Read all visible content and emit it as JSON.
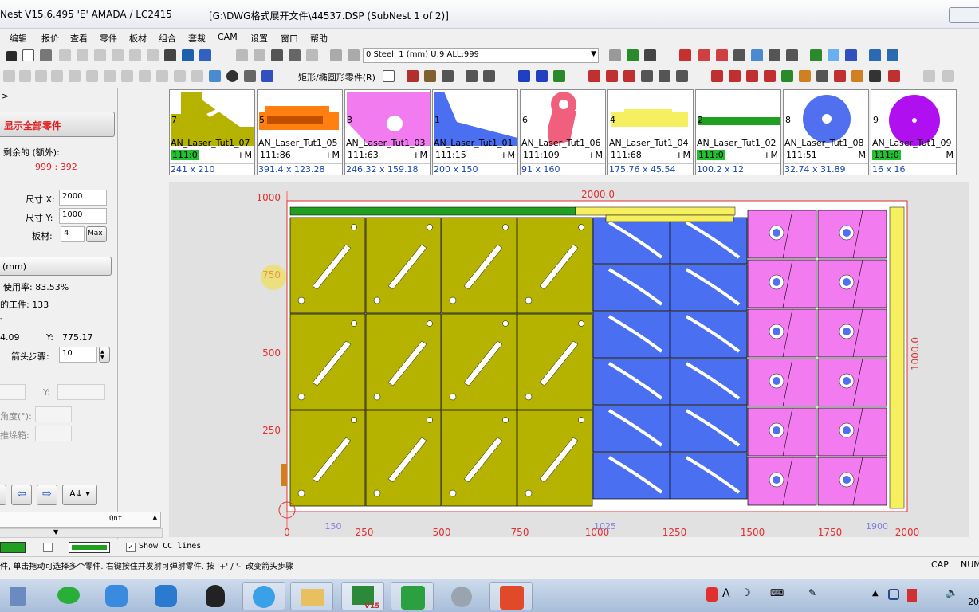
{
  "window": {
    "title_left": "Nest V15.6.495  'E'  AMADA / LC2415",
    "title_right": "[G:\\DWG格式展开文件\\44537.DSP (SubNest 1 of 2)]"
  },
  "menu": [
    "编辑",
    "报价",
    "查看",
    "零件",
    "板材",
    "组合",
    "套裁",
    "CAM",
    "设置",
    "窗口",
    "帮助"
  ],
  "toolbar": {
    "sheet_info": "0  Steel, 1 (mm)    U:9 ALL:999",
    "rect_parts_label": "矩形/椭圆形零件(R)"
  },
  "left_panel": {
    "arrow_text": ">",
    "show_all_button": "显示全部零件",
    "remaining_label": "剩余的 (额外):",
    "remaining_value": "999 : 392",
    "size_x_label": "尺寸 X:",
    "size_x_value": "2000",
    "size_y_label": "尺寸 Y:",
    "size_y_value": "1000",
    "plate_label": "板材:",
    "plate_value": "4",
    "max_label": "Max",
    "unit_label": "(mm)",
    "usage_label": "使用率: 83.53%",
    "workpieces_label": "的工件: 133",
    "coord_x": "4.09",
    "coord_y_label": "Y:",
    "coord_y": "775.17",
    "arrow_step_label": "箭头步骤:",
    "arrow_step_value": "10",
    "y_label": "Y:",
    "angle_label": "角度(°):",
    "stack_label": "推垛箱:",
    "qnt_label": "Qnt"
  },
  "parts": [
    {
      "num": "7",
      "name": "AN_Laser_Tut1_07",
      "qty": "111:0",
      "qty_green": true,
      "flag": "+M",
      "size": "241 x 210",
      "color": "#b5b200"
    },
    {
      "num": "5",
      "name": "AN_Laser_Tut1_05",
      "qty": "111:86",
      "qty_green": false,
      "flag": "+M",
      "size": "391.4 x 123.28",
      "color": "#ff8010"
    },
    {
      "num": "3",
      "name": "AN_Laser_Tut1_03",
      "qty": "111:63",
      "qty_green": false,
      "flag": "+M",
      "size": "246.32 x 159.18",
      "color": "#f27bf0"
    },
    {
      "num": "1",
      "name": "AN_Laser_Tut1_01",
      "qty": "111:15",
      "qty_green": false,
      "flag": "+M",
      "size": "200 x 150",
      "color": "#4a6ff0"
    },
    {
      "num": "6",
      "name": "AN_Laser_Tut1_06",
      "qty": "111:109",
      "qty_green": false,
      "flag": "+M",
      "size": "91 x 160",
      "color": "#f0607c"
    },
    {
      "num": "4",
      "name": "AN_Laser_Tut1_04",
      "qty": "111:68",
      "qty_green": false,
      "flag": "+M",
      "size": "175.76 x 45.54",
      "color": "#f6f060"
    },
    {
      "num": "2",
      "name": "AN_Laser_Tut1_02",
      "qty": "111:0",
      "qty_green": true,
      "flag": "+M",
      "size": "100.2 x 12",
      "color": "#20a020"
    },
    {
      "num": "8",
      "name": "AN_Laser_Tut1_08",
      "qty": "111:51",
      "qty_green": false,
      "flag": "M",
      "size": "32.74 x 31.89",
      "color": "#5070f0"
    },
    {
      "num": "9",
      "name": "AN_Laser_Tut1_09",
      "qty": "111:0",
      "qty_green": true,
      "flag": "M",
      "size": "16 x 16",
      "color": "#b010f0"
    }
  ],
  "sheet": {
    "width_label": "2000.0",
    "height_label": "1000.0",
    "y_ticks": [
      "1000",
      "750",
      "500",
      "250",
      "0"
    ],
    "x_ticks": [
      "0",
      "250",
      "500",
      "750",
      "1000",
      "1250",
      "1500",
      "1750",
      "2000"
    ],
    "x_marks": [
      "150",
      "1025",
      "1900"
    ]
  },
  "bottom": {
    "show_cc_lines": "Show CC lines",
    "status_text": "件, 单击拖动可选择多个零件. 右键按住并发射可弹射零件. 按 '+' / '-' 改变箭头步骤",
    "cap": "CAP",
    "num": "NUM"
  },
  "taskbar": {
    "v15": "V15",
    "clock": "20"
  },
  "colors": {
    "olive": "#b5b200",
    "blue": "#4a6ff0",
    "pink": "#f27bf0",
    "green": "#20a020",
    "tick": "#e03030"
  }
}
